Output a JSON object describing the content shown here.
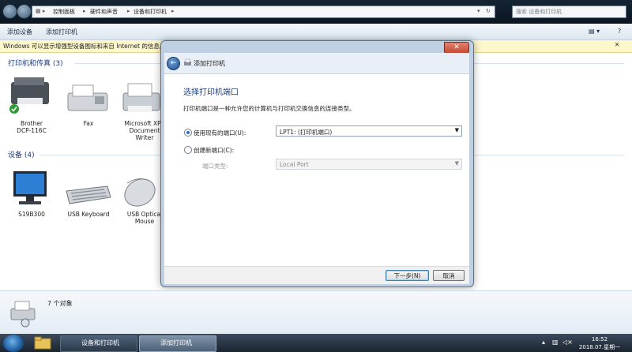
{
  "address": {
    "crumbs": [
      "控制面板",
      "硬件和声音",
      "设备和打印机"
    ],
    "search_placeholder": "搜索 设备和打印机"
  },
  "toolbar": {
    "add_device": "添加设备",
    "add_printer": "添加打印机"
  },
  "infobar": {
    "text": "Windows 可以显示增强型设备图标和来自 Internet 的信息。"
  },
  "printers_section": {
    "title": "打印机和传真 (3)",
    "items": [
      {
        "label": "Brother\nDCP-116C"
      },
      {
        "label": "Fax"
      },
      {
        "label": "Microsoft XPS\nDocument\nWriter"
      }
    ]
  },
  "devices_section": {
    "title": "设备 (4)",
    "items": [
      {
        "label": "S19B300"
      },
      {
        "label": "USB Keyboard"
      },
      {
        "label": "USB Optical\nMouse"
      }
    ]
  },
  "dialog": {
    "close": "✕",
    "title": "添加打印机",
    "heading": "选择打印机端口",
    "description": "打印机端口是一种允许您的计算机与打印机交换信息的连接类型。",
    "option_existing": "使用现有的端口(U):",
    "existing_port": "LPT1: (打印机端口)",
    "option_new": "创建新端口(C):",
    "port_type_label": "端口类型:",
    "port_type_value": "Local Port",
    "next_button": "下一步(N)",
    "cancel_button": "取消"
  },
  "status": {
    "count": "7 个对象"
  },
  "taskbar": {
    "items": [
      "设备和打印机",
      "添加打印机"
    ],
    "time": "16:52",
    "date": "2018.07.星期一"
  }
}
